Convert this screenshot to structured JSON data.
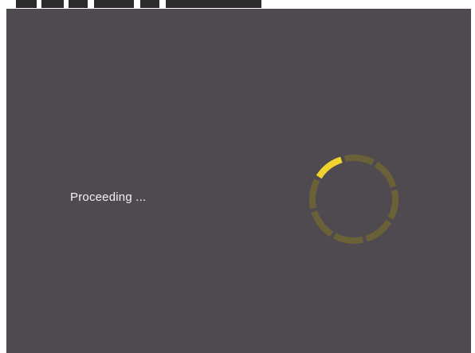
{
  "status": {
    "message": "Proceeding ..."
  },
  "spinner": {
    "icon": "loading-spinner-icon",
    "segments": 8,
    "active_segment": 0,
    "active_color": "#f2d22e",
    "inactive_color": "#6b6138"
  },
  "colors": {
    "background": "#4e4a4f",
    "text": "#f2f2f2"
  }
}
